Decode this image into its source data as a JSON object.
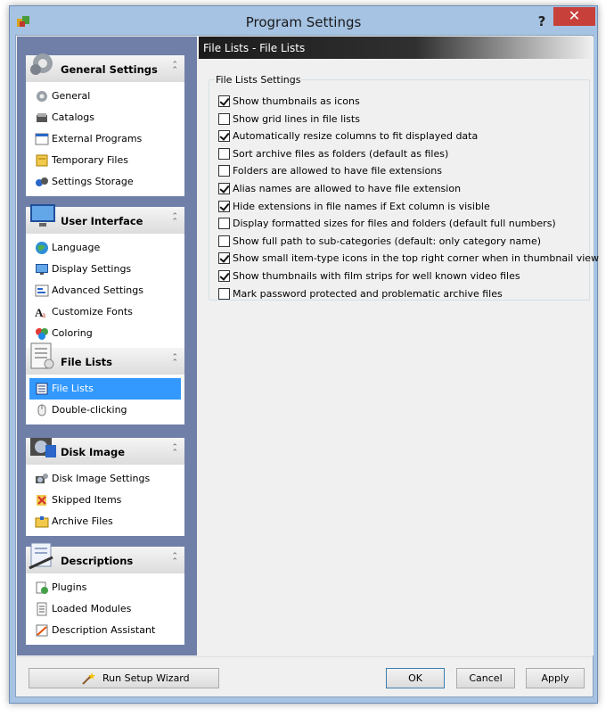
{
  "window": {
    "title": "Program Settings",
    "help_label": "?",
    "close_label": "✕"
  },
  "sidebar": {
    "groups": [
      {
        "title": "General Settings",
        "icon": "gear-icon",
        "items": [
          {
            "label": "General",
            "icon": "general-icon"
          },
          {
            "label": "Catalogs",
            "icon": "catalogs-icon"
          },
          {
            "label": "External Programs",
            "icon": "external-programs-icon"
          },
          {
            "label": "Temporary Files",
            "icon": "temporary-files-icon"
          },
          {
            "label": "Settings Storage",
            "icon": "settings-storage-icon"
          }
        ]
      },
      {
        "title": "User Interface",
        "icon": "monitor-icon",
        "items": [
          {
            "label": "Language",
            "icon": "globe-icon"
          },
          {
            "label": "Display Settings",
            "icon": "display-icon"
          },
          {
            "label": "Advanced Settings",
            "icon": "advanced-settings-icon"
          },
          {
            "label": "Customize Fonts",
            "icon": "fonts-icon"
          },
          {
            "label": "Coloring",
            "icon": "coloring-icon"
          }
        ]
      },
      {
        "title": "File Lists",
        "icon": "file-list-icon",
        "items": [
          {
            "label": "File Lists",
            "icon": "file-lists-icon",
            "selected": true
          },
          {
            "label": "Double-clicking",
            "icon": "mouse-icon"
          }
        ]
      },
      {
        "title": "Disk Image",
        "icon": "disk-image-icon",
        "items": [
          {
            "label": "Disk Image Settings",
            "icon": "disk-image-settings-icon"
          },
          {
            "label": "Skipped Items",
            "icon": "skipped-items-icon"
          },
          {
            "label": "Archive Files",
            "icon": "archive-files-icon"
          }
        ]
      },
      {
        "title": "Descriptions",
        "icon": "descriptions-icon",
        "items": [
          {
            "label": "Plugins",
            "icon": "plugins-icon"
          },
          {
            "label": "Loaded Modules",
            "icon": "loaded-modules-icon"
          },
          {
            "label": "Description Assistant",
            "icon": "description-assistant-icon"
          }
        ]
      }
    ]
  },
  "main": {
    "header": "File Lists - File Lists",
    "section_title": "File Lists Settings",
    "options": [
      {
        "label": "Show thumbnails as icons",
        "checked": true
      },
      {
        "label": "Show grid lines in file lists",
        "checked": false
      },
      {
        "label": "Automatically resize columns to fit displayed data",
        "checked": true
      },
      {
        "label": "Sort archive files as folders (default as files)",
        "checked": false
      },
      {
        "label": "Folders are allowed to have file extensions",
        "checked": false
      },
      {
        "label": "Alias names are allowed to have file extension",
        "checked": true
      },
      {
        "label": "Hide extensions in file names if Ext column is visible",
        "checked": true
      },
      {
        "label": "Display formatted sizes for files and folders (default full numbers)",
        "checked": false
      },
      {
        "label": "Show full path to sub-categories (default: only category name)",
        "checked": false
      },
      {
        "label": "Show small item-type icons in the top right corner when in thumbnail view",
        "checked": true
      },
      {
        "label": "Show thumbnails with film strips for well known video files",
        "checked": true
      },
      {
        "label": "Mark password protected and problematic archive files",
        "checked": false
      }
    ]
  },
  "footer": {
    "wizard_label": "Run Setup Wizard",
    "ok_label": "OK",
    "cancel_label": "Cancel",
    "apply_label": "Apply"
  },
  "colors": {
    "selection": "#3399ff",
    "close": "#c7403a",
    "sidebar_bg": "#6f7fa8",
    "titlebar": "#a6c3e3"
  }
}
